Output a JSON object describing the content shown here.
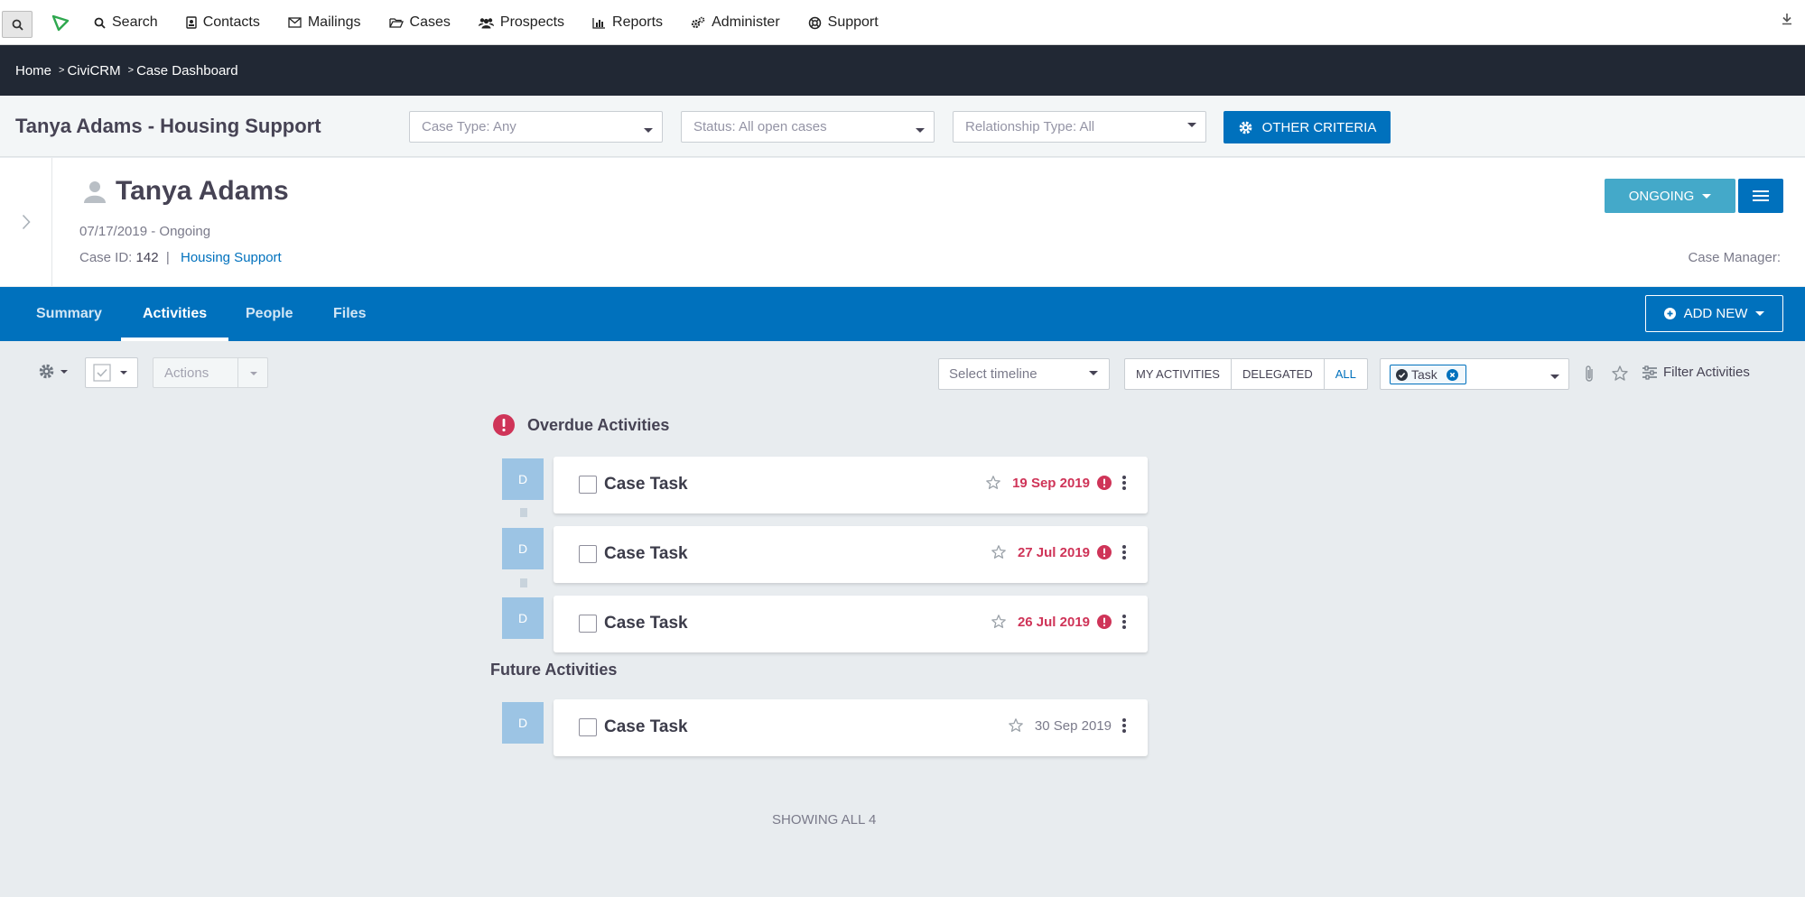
{
  "topmenu": {
    "items": [
      {
        "label": "Search",
        "icon": "search-icon"
      },
      {
        "label": "Contacts",
        "icon": "contact-card-icon"
      },
      {
        "label": "Mailings",
        "icon": "envelope-icon"
      },
      {
        "label": "Cases",
        "icon": "folder-open-icon"
      },
      {
        "label": "Prospects",
        "icon": "users-icon"
      },
      {
        "label": "Reports",
        "icon": "bar-chart-icon"
      },
      {
        "label": "Administer",
        "icon": "cogs-icon"
      },
      {
        "label": "Support",
        "icon": "life-ring-icon"
      }
    ]
  },
  "breadcrumb": [
    "Home",
    "CiviCRM",
    "Case Dashboard"
  ],
  "page": {
    "title": "Tanya Adams - Housing Support",
    "filters": {
      "case_type": "Case Type: Any",
      "status": "Status: All open cases",
      "relationship": "Relationship Type: All",
      "other_criteria": "Other criteria"
    }
  },
  "case": {
    "name": "Tanya Adams",
    "meta": "07/17/2019 - Ongoing",
    "case_id_label": "Case ID:",
    "case_id": "142",
    "case_type": "Housing Support",
    "case_manager_label": "Case Manager:",
    "status_button": "Ongoing"
  },
  "tabs": [
    "Summary",
    "Activities",
    "People",
    "Files"
  ],
  "active_tab": "Activities",
  "add_new": "Add new",
  "toolbar": {
    "actions": "Actions",
    "timeline_placeholder": "Select timeline",
    "segments": [
      "My activities",
      "Delegated",
      "All"
    ],
    "tag": "Task",
    "filter_label": "Filter Activities"
  },
  "overdue": {
    "title": "Overdue Activities",
    "items": [
      {
        "avatar": "D",
        "title": "Case Task",
        "date": "19 Sep 2019"
      },
      {
        "avatar": "D",
        "title": "Case Task",
        "date": "27 Jul 2019"
      },
      {
        "avatar": "D",
        "title": "Case Task",
        "date": "26 Jul 2019"
      }
    ]
  },
  "future": {
    "title": "Future Activities",
    "items": [
      {
        "avatar": "D",
        "title": "Case Task",
        "date": "30 Sep 2019"
      }
    ]
  },
  "showing": "Showing all 4",
  "colors": {
    "brand_blue": "#0071bd",
    "dark_bar": "#212834",
    "overdue_red": "#cf3458",
    "status_teal": "#44a9c9",
    "avatar_blue": "#9cc4e4"
  }
}
